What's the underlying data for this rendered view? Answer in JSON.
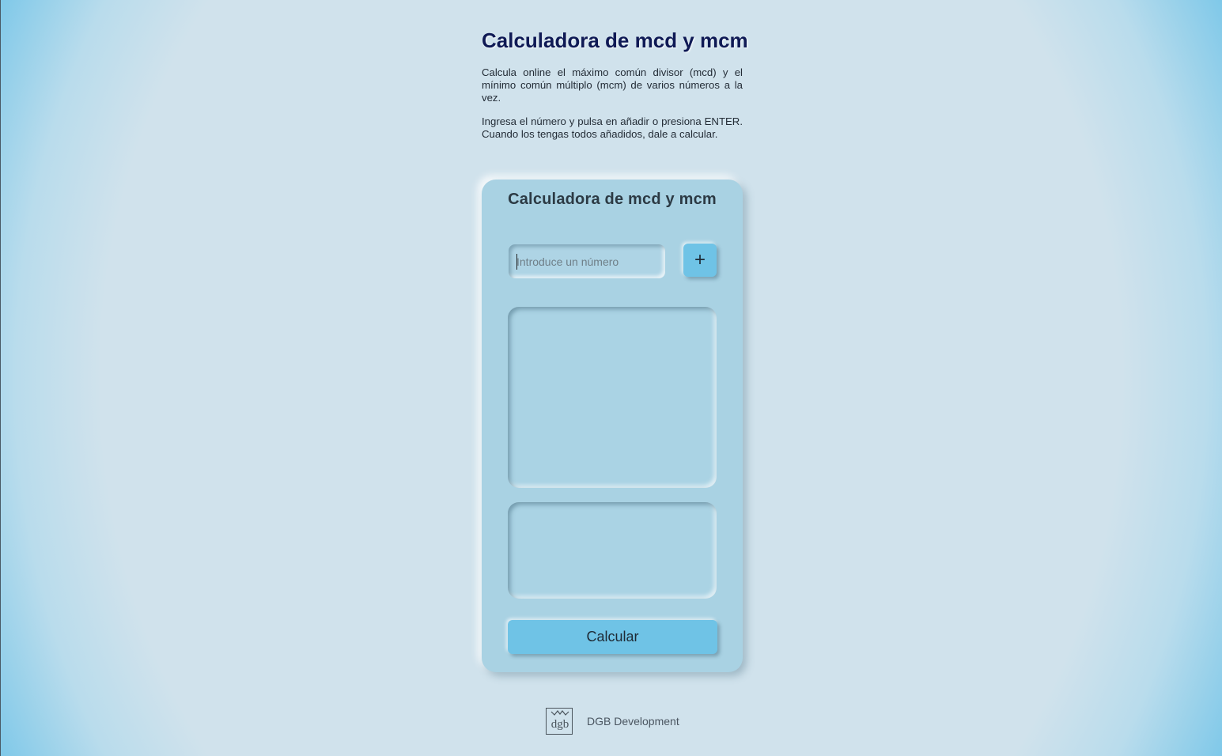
{
  "page": {
    "title": "Calculadora de mcd y mcm",
    "description_1": "Calcula online el máximo común divisor (mcd) y el mínimo común múltiplo (mcm) de varios números a la vez.",
    "description_2": "Ingresa el número y pulsa en añadir o presiona ENTER. Cuando los tengas todos añadidos, dale a calcular."
  },
  "calculator": {
    "title": "Calculadora de mcd y mcm",
    "input_value": "",
    "input_placeholder": "Introduce un número",
    "add_label": "+",
    "calculate_label": "Calcular"
  },
  "footer": {
    "logo": "dgb",
    "text": "DGB Development"
  },
  "colors": {
    "background": "#d0e2ec",
    "card": "#a9d2e3",
    "button": "#6fc3e6",
    "title": "#0f1a55"
  }
}
